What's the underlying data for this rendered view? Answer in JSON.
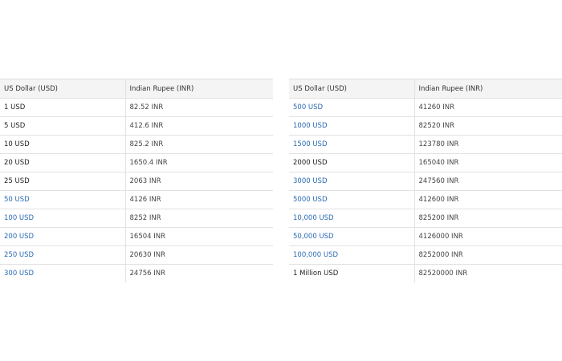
{
  "headers": {
    "usd": "US Dollar (USD)",
    "inr": "Indian Rupee (INR)"
  },
  "link_color": "#2a6ab3",
  "tables": [
    {
      "rows": [
        {
          "usd": "1 USD",
          "inr": "82.52 INR",
          "link": false
        },
        {
          "usd": "5 USD",
          "inr": "412.6 INR",
          "link": false
        },
        {
          "usd": "10 USD",
          "inr": "825.2 INR",
          "link": false
        },
        {
          "usd": "20 USD",
          "inr": "1650.4 INR",
          "link": false
        },
        {
          "usd": "25 USD",
          "inr": "2063 INR",
          "link": false
        },
        {
          "usd": "50 USD",
          "inr": "4126 INR",
          "link": true
        },
        {
          "usd": "100 USD",
          "inr": "8252 INR",
          "link": true
        },
        {
          "usd": "200 USD",
          "inr": "16504 INR",
          "link": true
        },
        {
          "usd": "250 USD",
          "inr": "20630 INR",
          "link": true
        },
        {
          "usd": "300 USD",
          "inr": "24756 INR",
          "link": true
        }
      ]
    },
    {
      "rows": [
        {
          "usd": "500 USD",
          "inr": "41260 INR",
          "link": true
        },
        {
          "usd": "1000 USD",
          "inr": "82520 INR",
          "link": true
        },
        {
          "usd": "1500 USD",
          "inr": "123780 INR",
          "link": true
        },
        {
          "usd": "2000 USD",
          "inr": "165040 INR",
          "link": false
        },
        {
          "usd": "3000 USD",
          "inr": "247560 INR",
          "link": true
        },
        {
          "usd": "5000 USD",
          "inr": "412600 INR",
          "link": true
        },
        {
          "usd": "10,000 USD",
          "inr": "825200 INR",
          "link": true
        },
        {
          "usd": "50,000 USD",
          "inr": "4126000 INR",
          "link": true
        },
        {
          "usd": "100,000 USD",
          "inr": "8252000 INR",
          "link": true
        },
        {
          "usd": "1 Million USD",
          "inr": "82520000 INR",
          "link": false
        }
      ]
    }
  ]
}
